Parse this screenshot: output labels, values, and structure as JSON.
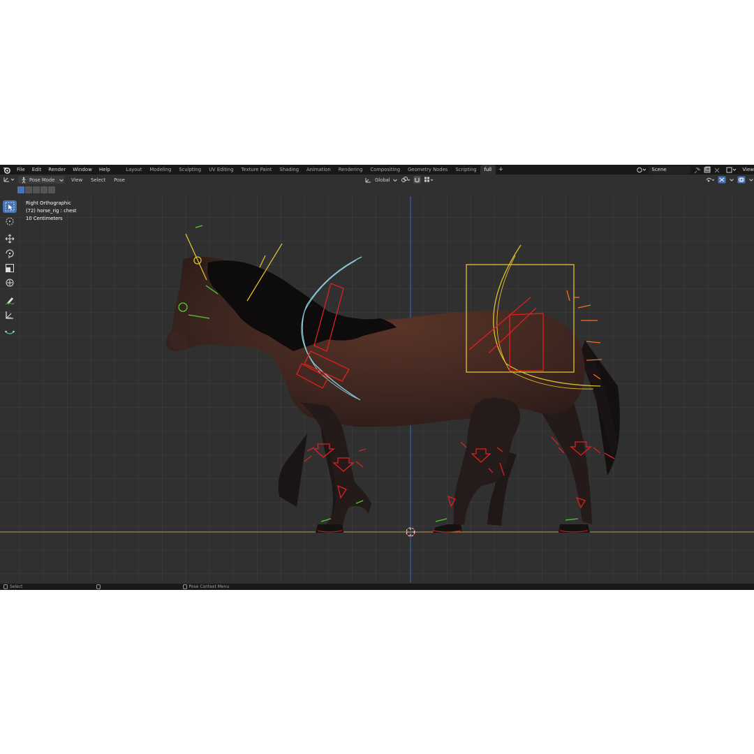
{
  "topbar": {
    "menus": [
      "File",
      "Edit",
      "Render",
      "Window",
      "Help"
    ],
    "workspace_tabs": [
      "Layout",
      "Modeling",
      "Sculpting",
      "UV Editing",
      "Texture Paint",
      "Shading",
      "Animation",
      "Rendering",
      "Compositing",
      "Geometry Nodes",
      "Scripting",
      "full"
    ],
    "active_tab": "full",
    "add_tab": "+",
    "scene_name": "Scene",
    "view_layer_label": "View"
  },
  "header": {
    "mode": "Pose Mode",
    "menus": [
      "View",
      "Select",
      "Pose"
    ],
    "orientation": "Global"
  },
  "viewport": {
    "view_name": "Right Orthographic",
    "object_info": "(72) horse_rig : chest",
    "grid_scale": "10 Centimeters"
  },
  "toolbar": {
    "tools": [
      "select-box-icon",
      "cursor-icon",
      "move-icon",
      "rotate-icon",
      "scale-icon",
      "transform-icon",
      "annotate-icon",
      "measure-icon",
      "relax-pose-icon"
    ]
  },
  "statusbar": {
    "left_action": "Select",
    "right_action": "Pose Context Menu"
  },
  "colors": {
    "bone_red": "#e02020",
    "bone_yellow": "#e0c030",
    "bone_cyan": "#88ccd8",
    "bone_green": "#50d030",
    "bone_orange": "#ff6a20",
    "accent_blue": "#4772b3",
    "axis_blue": "#2f6fc9",
    "ground_line": "#b89a5a"
  }
}
